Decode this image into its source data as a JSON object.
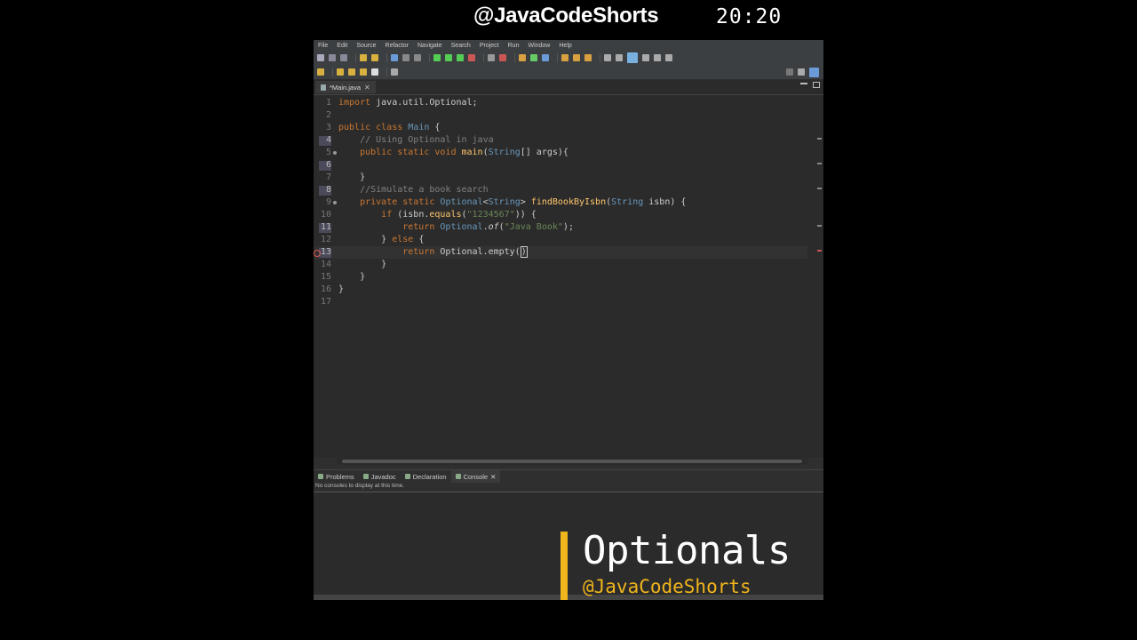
{
  "overlay": {
    "channel": "@JavaCodeShorts",
    "clock": "20:20",
    "title": "Optionals",
    "handle": "@JavaCodeShorts",
    "accent": "#f0b41c"
  },
  "menubar": [
    "File",
    "Edit",
    "Source",
    "Refactor",
    "Navigate",
    "Search",
    "Project",
    "Run",
    "Window",
    "Help"
  ],
  "editor": {
    "tab_label": "*Main.java",
    "tab_close": "✕",
    "lines": [
      {
        "n": "1",
        "html": "<span class=\"kw\">import</span> java.util.Optional;"
      },
      {
        "n": "2",
        "html": ""
      },
      {
        "n": "3",
        "html": "<span class=\"kw\">public class</span> <span class=\"ty\">Main</span> {"
      },
      {
        "n": "4",
        "html": "    <span class=\"cm\">// Using Optional in java</span>",
        "mark": true
      },
      {
        "n": "5",
        "html": "    <span class=\"kw\">public static void</span> <span class=\"fn\">main</span>(<span class=\"ty\">String</span>[] args){",
        "fold": true
      },
      {
        "n": "6",
        "html": "",
        "mark": true
      },
      {
        "n": "7",
        "html": "    }"
      },
      {
        "n": "8",
        "html": "    <span class=\"cm\">//Simulate a book search</span>",
        "mark": true
      },
      {
        "n": "9",
        "html": "    <span class=\"kw\">private static</span> <span class=\"ty\">Optional</span>&lt;<span class=\"ty\">String</span>&gt; <span class=\"fn\">findBookByIsbn</span>(<span class=\"ty\">String</span> isbn) {",
        "fold": true
      },
      {
        "n": "10",
        "html": "        <span class=\"kw\">if</span> (isbn.<span class=\"fn\">equals</span>(<span class=\"str\">\"1234567\"</span>)) {"
      },
      {
        "n": "11",
        "html": "            <span class=\"kw\">return</span> <span class=\"ty\">Optional</span>.<i>of</i>(<span class=\"str\">\"Java Book\"</span>);",
        "mark": true
      },
      {
        "n": "12",
        "html": "        } <span class=\"kw\">else</span> {"
      },
      {
        "n": "13",
        "html": "            <span class=\"kw\">return</span> Optional.empty(<span class=\"caret\">)</span>",
        "mark": true,
        "error": true,
        "current": true
      },
      {
        "n": "14",
        "html": "        }"
      },
      {
        "n": "15",
        "html": "    }"
      },
      {
        "n": "16",
        "html": "}"
      },
      {
        "n": "17",
        "html": ""
      }
    ]
  },
  "bottom_panel": {
    "tabs": [
      {
        "label": "Problems",
        "active": false
      },
      {
        "label": "Javadoc",
        "active": false
      },
      {
        "label": "Declaration",
        "active": false
      },
      {
        "label": "Console",
        "active": true
      }
    ],
    "status": "No consoles to display at this time."
  }
}
